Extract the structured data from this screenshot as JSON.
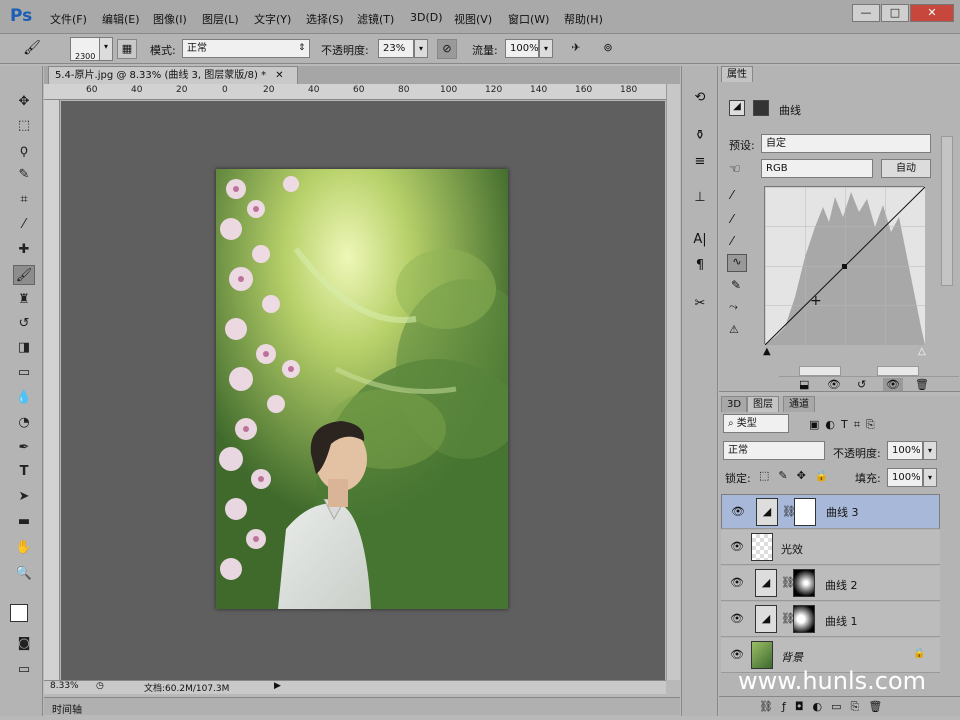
{
  "app": {
    "logo": "Ps"
  },
  "menu": [
    "文件(F)",
    "编辑(E)",
    "图像(I)",
    "图层(L)",
    "文字(Y)",
    "选择(S)",
    "滤镜(T)",
    "3D(D)",
    "视图(V)",
    "窗口(W)",
    "帮助(H)"
  ],
  "window_controls": {
    "minimize": "—",
    "maximize": "□",
    "close": "✕"
  },
  "options": {
    "brush_size": "2300",
    "mode_label": "模式:",
    "mode_value": "正常",
    "opacity_label": "不透明度:",
    "opacity_value": "23%",
    "flow_label": "流量:",
    "flow_value": "100%"
  },
  "document": {
    "tab_title": "5.4-原片.jpg @ 8.33% (曲线 3, 图层蒙版/8) *",
    "ruler_ticks": [
      "60",
      "40",
      "20",
      "0",
      "20",
      "40",
      "60",
      "80",
      "100",
      "120",
      "140",
      "160",
      "180"
    ],
    "zoom": "8.33%",
    "doc_size": "文档:60.2M/107.3M",
    "timeline_label": "时间轴"
  },
  "properties": {
    "tab": "属性",
    "panel_title": "曲线",
    "preset_label": "预设:",
    "preset_value": "自定",
    "channel_value": "RGB",
    "auto_button": "自动"
  },
  "layers_panel": {
    "tabs": [
      "3D",
      "图层",
      "通道"
    ],
    "filter_value": "类型",
    "blend_value": "正常",
    "opacity_label": "不透明度:",
    "opacity_value": "100%",
    "lock_label": "锁定:",
    "fill_label": "填充:",
    "fill_value": "100%",
    "layers": [
      {
        "name": "曲线 3",
        "selected": true
      },
      {
        "name": "光效",
        "selected": false
      },
      {
        "name": "曲线 2",
        "selected": false
      },
      {
        "name": "曲线 1",
        "selected": false
      },
      {
        "name": "背景",
        "selected": false
      }
    ]
  },
  "watermark": "www.hunls.com",
  "colors": {
    "accent": "#1b5fb5",
    "selected_layer": "#a8b8d8",
    "canvas_bg": "#5f5f5f"
  }
}
